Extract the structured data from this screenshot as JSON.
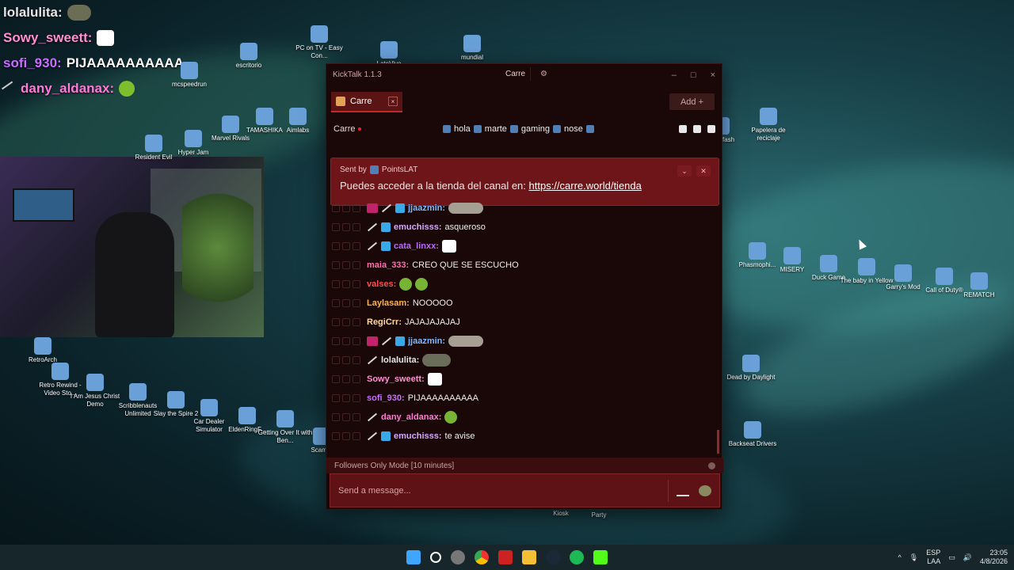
{
  "overlay_chat": [
    {
      "user": "lolalulita:",
      "color": "#e6e6e6",
      "emote": "frog"
    },
    {
      "user": "Sowy_sweett:",
      "color": "#ff8fd2",
      "emote": "mute"
    },
    {
      "user": "sofi_930:",
      "text": "PIJAAAAAAAAAA",
      "color": "#c96cff"
    },
    {
      "user": "dany_aldanax:",
      "color": "#ff7ad8",
      "emote": "pepe"
    }
  ],
  "desktop_icons": [
    {
      "label": "PC on TV - Easy Con..."
    },
    {
      "label": "LatoVivo"
    },
    {
      "label": "mundial"
    },
    {
      "label": "escritorio"
    },
    {
      "label": "mcspeedrun"
    },
    {
      "label": "TAMASHIKA"
    },
    {
      "label": "Aimlabs"
    },
    {
      "label": "Velo"
    },
    {
      "label": "Marvel Rivals"
    },
    {
      "label": "Hyper Jam"
    },
    {
      "label": "Resident Evil"
    },
    {
      "label": "RetroArch"
    },
    {
      "label": "Retro Rewind - Video Sto..."
    },
    {
      "label": "I Am Jesus Christ Demo"
    },
    {
      "label": "Scribblenauts Unlimited"
    },
    {
      "label": "Slay the Spire 2"
    },
    {
      "label": "Car Dealer Simulator"
    },
    {
      "label": "EldenRingF..."
    },
    {
      "label": "Getting Over It with Ben..."
    },
    {
      "label": "Scam L"
    },
    {
      "label": "dolsofash"
    },
    {
      "label": "Papelera de reciclaje"
    },
    {
      "label": "Phasmophi..."
    },
    {
      "label": "MISERY"
    },
    {
      "label": "Duck Game"
    },
    {
      "label": "The baby in Yellow"
    },
    {
      "label": "Garry's Mod"
    },
    {
      "label": "Call of Duty®"
    },
    {
      "label": "REMATCH"
    },
    {
      "label": "Dead by Daylight"
    },
    {
      "label": "Backseat Drivers"
    },
    {
      "label": "Kiosk"
    },
    {
      "label": "Party"
    }
  ],
  "window": {
    "title": "KickTalk 1.1.3",
    "channel_pill": "Carre",
    "min": "–",
    "max": "□",
    "close": "×"
  },
  "tabs": [
    {
      "label": "Carre",
      "close": "×"
    }
  ],
  "add_button": "Add  +",
  "channel_bar": {
    "name": "Carre",
    "tags": [
      "hola",
      "marte",
      "gaming",
      "nose"
    ]
  },
  "pinned": {
    "sent_by": "Sent by",
    "author": "PointsLAT",
    "text": "Puedes acceder a la tienda del canal en: ",
    "link": "https://carre.world/tienda",
    "collapse": "⌄",
    "unpin": "✕"
  },
  "messages": [
    {
      "user": "jjaazmin:",
      "text": "",
      "color": "#7fb7ff",
      "sub": true,
      "sword": true,
      "cube": true,
      "emote": "wide"
    },
    {
      "user": "emuchisss:",
      "text": "asqueroso",
      "color": "#d7a7ff",
      "sword": true,
      "cube": true
    },
    {
      "user": "cata_linxx:",
      "text": "",
      "color": "#b86bff",
      "sword": true,
      "cube": true,
      "emote": "mute"
    },
    {
      "user": "maia_333:",
      "text": "CREO QUE SE ESCUCHO",
      "color": "#ff6fb1"
    },
    {
      "user": "valses:",
      "text": "",
      "color": "#ff4d4d",
      "emote": "pepe2"
    },
    {
      "user": "Laylasam:",
      "text": "NOOOOO",
      "color": "#ffb347"
    },
    {
      "user": "RegiCrr:",
      "text": "JAJAJAJAJAJ",
      "color": "#ffd7a0"
    },
    {
      "user": "jjaazmin:",
      "text": "",
      "color": "#7fb7ff",
      "sub": true,
      "sword": true,
      "cube": true,
      "emote": "wide"
    },
    {
      "user": "lolalulita:",
      "text": "",
      "color": "#e6e6e6",
      "sword": true,
      "emote": "frog"
    },
    {
      "user": "Sowy_sweett:",
      "text": "",
      "color": "#ff8fd2",
      "emote": "mute"
    },
    {
      "user": "sofi_930:",
      "text": "PIJAAAAAAAAAA",
      "color": "#c96cff"
    },
    {
      "user": "dany_aldanax:",
      "text": "",
      "color": "#ff7ad8",
      "sword": true,
      "emote": "pepe"
    },
    {
      "user": "emuchisss:",
      "text": "te avise",
      "color": "#d7a7ff",
      "sword": true,
      "cube": true
    }
  ],
  "followers_mode": "Followers Only Mode [10 minutes]",
  "composer": {
    "placeholder": "Send a message..."
  },
  "taskbar": {
    "lang_top": "ESP",
    "lang_bottom": "LAA",
    "time": "23:05",
    "date": "4/8/2026"
  }
}
